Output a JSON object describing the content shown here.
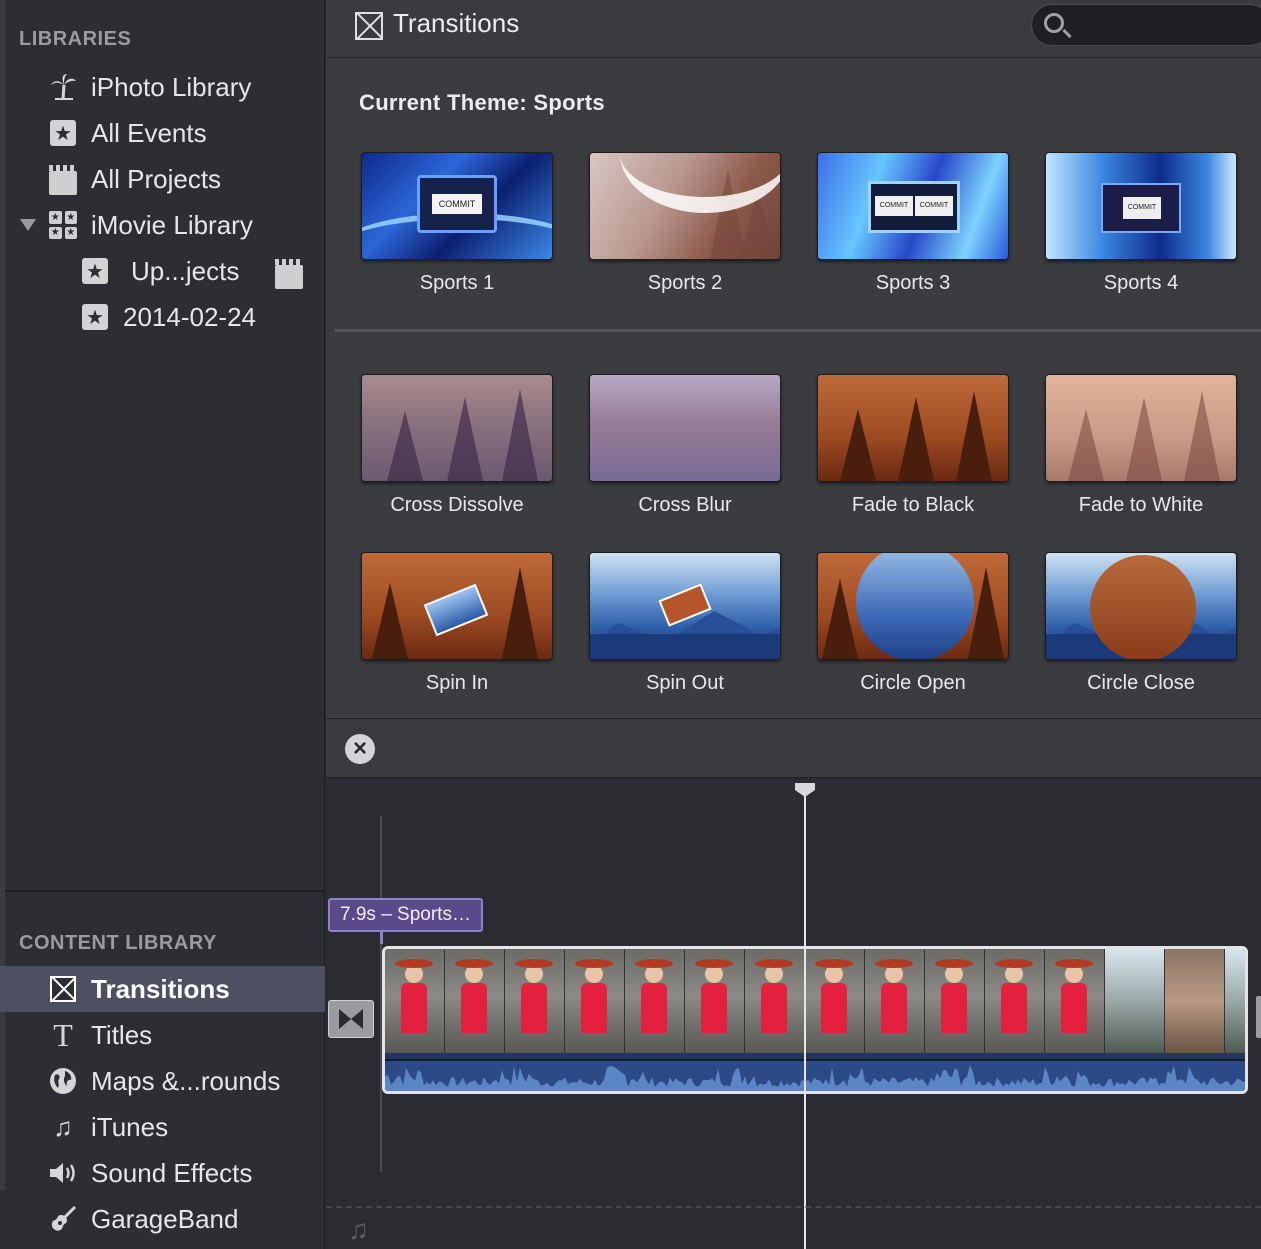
{
  "sidebar": {
    "libraries_header": "LIBRARIES",
    "libraries": [
      {
        "label": "iPhoto Library",
        "icon": "palm-tree-icon"
      },
      {
        "label": "All Events",
        "icon": "star-icon"
      },
      {
        "label": "All Projects",
        "icon": "clapboard-icon"
      },
      {
        "label": "iMovie Library",
        "icon": "grid-icon",
        "expanded": true
      },
      {
        "label": "Up...jects",
        "icon": "star-icon"
      },
      {
        "label": "2014-02-24",
        "icon": "star-icon"
      }
    ],
    "content_header": "CONTENT LIBRARY",
    "content": [
      {
        "label": "Transitions",
        "icon": "transitions-icon",
        "selected": true
      },
      {
        "label": "Titles",
        "icon": "titles-icon"
      },
      {
        "label": "Maps &...rounds",
        "icon": "globe-icon"
      },
      {
        "label": "iTunes",
        "icon": "music-note-icon"
      },
      {
        "label": "Sound Effects",
        "icon": "speaker-icon"
      },
      {
        "label": "GarageBand",
        "icon": "guitar-icon"
      }
    ]
  },
  "header": {
    "title": "Transitions",
    "search_placeholder": ""
  },
  "browser": {
    "theme_label": "Current Theme: Sports",
    "theme_tiles": [
      "Sports 1",
      "Sports 2",
      "Sports 3",
      "Sports 4"
    ],
    "standard_tiles": [
      "Cross Dissolve",
      "Cross Blur",
      "Fade to Black",
      "Fade to White",
      "Spin In",
      "Spin Out",
      "Circle Open",
      "Circle Close"
    ]
  },
  "timeline": {
    "clip_tag": "7.9s – Sports…"
  },
  "colors": {
    "sidebar_bg": "#2d2e33",
    "selected_row": "#4d5060",
    "browser_bg": "#3b3c40",
    "clip_tag": "#5a4a8c",
    "audio_wave": "#5a86c6"
  }
}
